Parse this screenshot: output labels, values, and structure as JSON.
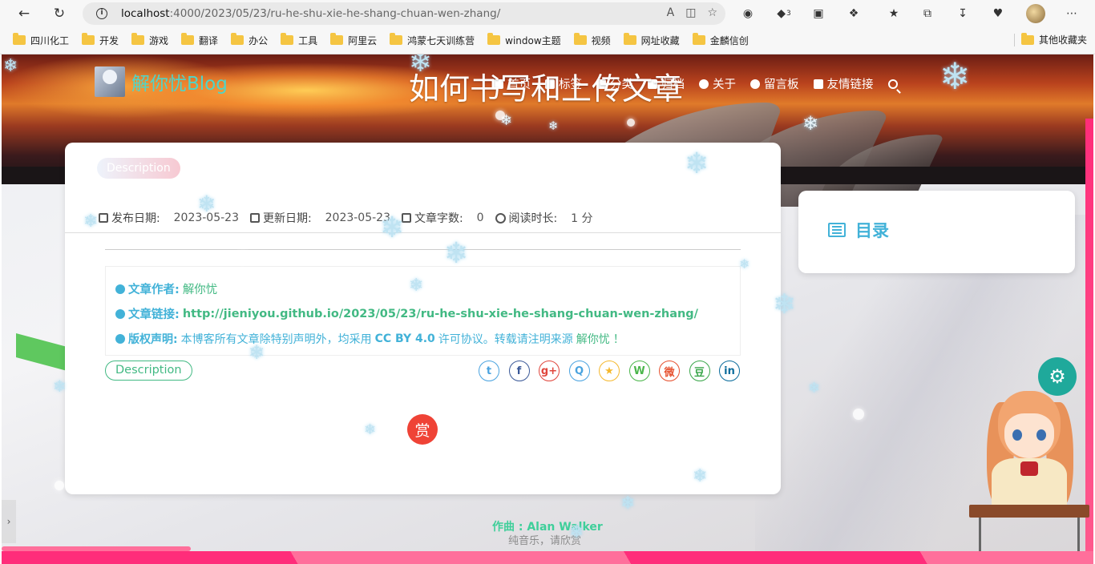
{
  "browser": {
    "url_host": "localhost",
    "url_path": ":4000/2023/05/23/ru-he-shu-xie-he-shang-chuan-wen-zhang/",
    "ext_badge": "3",
    "bookmarks": [
      "四川化工",
      "开发",
      "游戏",
      "翻译",
      "办公",
      "工具",
      "阿里云",
      "鸿蒙七天训练营",
      "window主题",
      "视频",
      "网址收藏",
      "金麟信创"
    ],
    "other_bookmarks": "其他收藏夹"
  },
  "site": {
    "logo_text": "解你忧Blog",
    "page_title": "如何书写和上传文章",
    "menu": [
      "首页",
      "标签",
      "分类",
      "归档",
      "关于",
      "留言板",
      "友情链接"
    ]
  },
  "post": {
    "description_chip": "Description",
    "meta": {
      "publish_label": "发布日期:",
      "publish_date": "2023-05-23",
      "update_label": "更新日期:",
      "update_date": "2023-05-23",
      "words_label": "文章字数:",
      "words": "0",
      "read_label": "阅读时长:",
      "read_time": "1 分"
    },
    "copyright": {
      "author_label": "文章作者:",
      "author": "解你忧",
      "link_label": "文章链接:",
      "link": "http://jieniyou.github.io/2023/05/23/ru-he-shu-xie-he-shang-chuan-wen-zhang/",
      "license_label": "版权声明:",
      "license_pre": "本博客所有文章除特别声明外，均采用",
      "license_name": "CC BY 4.0",
      "license_post": "许可协议。转载请注明来源",
      "license_author": "解你忧",
      "license_end": "！"
    },
    "tag": "Description",
    "share_icons": [
      {
        "icon": "twitter-icon",
        "glyph": "t",
        "color": "#4aa3df"
      },
      {
        "icon": "facebook-icon",
        "glyph": "f",
        "color": "#3b5998"
      },
      {
        "icon": "google-plus-icon",
        "glyph": "g+",
        "color": "#e0463c"
      },
      {
        "icon": "qq-icon",
        "glyph": "Q",
        "color": "#4aa3df"
      },
      {
        "icon": "qzone-icon",
        "glyph": "★",
        "color": "#f5b82e"
      },
      {
        "icon": "wechat-icon",
        "glyph": "W",
        "color": "#4cb64c"
      },
      {
        "icon": "weibo-icon",
        "glyph": "微",
        "color": "#e6502e"
      },
      {
        "icon": "douban-icon",
        "glyph": "豆",
        "color": "#3aa64a"
      },
      {
        "icon": "linkedin-icon",
        "glyph": "in",
        "color": "#0b6c9c"
      }
    ],
    "reward": "赏"
  },
  "toc": {
    "title": "目录"
  },
  "music": {
    "composer": "作曲 : Alan Walker",
    "note": "纯音乐，请欣赏"
  }
}
